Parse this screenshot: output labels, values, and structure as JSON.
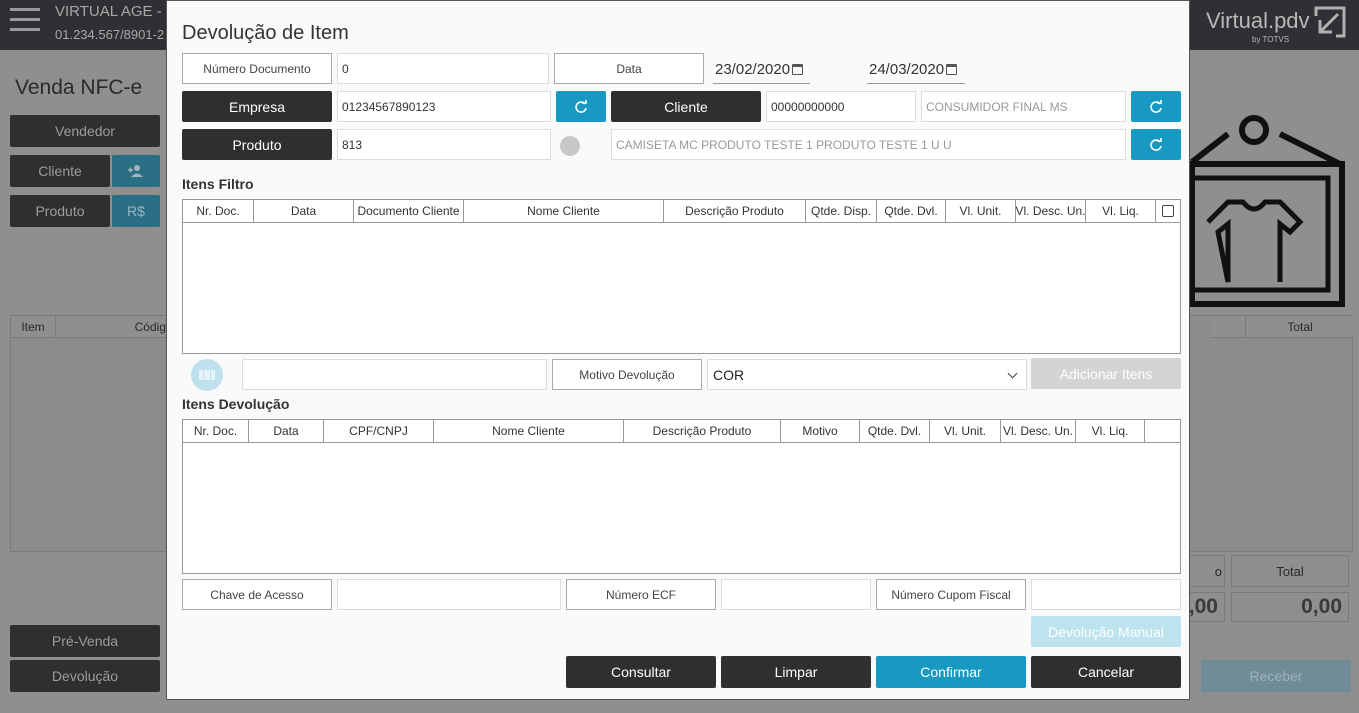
{
  "background": {
    "company_name": "VIRTUAL AGE - D",
    "cnpj": "01.234.567/8901-2",
    "brand": "Virtual.pdv",
    "brand_sub": "by TOTVS",
    "page_title": "Venda NFC-e",
    "buttons": {
      "vendedor": "Vendedor",
      "cliente": "Cliente",
      "produto": "Produto",
      "produto_side": "R$",
      "pre_venda": "Pré-Venda",
      "devolucao": "Devolução",
      "receber": "Receber"
    },
    "table_headers": {
      "item": "Item",
      "codigo": "Códig",
      "total": "Total"
    },
    "totals": {
      "label": "Total",
      "value": "0,00",
      "value_partial": ",00",
      "label_partial": "o"
    }
  },
  "modal": {
    "title": "Devolução de Item",
    "numero_documento_label": "Número Documento",
    "numero_documento_value": "0",
    "data_label": "Data",
    "date_start": "23/02/2020",
    "date_end": "24/03/2020",
    "empresa_label": "Empresa",
    "empresa_value": "01234567890123",
    "cliente_label": "Cliente",
    "cliente_value": "00000000000",
    "cliente_name": "CONSUMIDOR FINAL MS",
    "produto_label": "Produto",
    "produto_value": "813",
    "produto_desc": "CAMISETA MC PRODUTO TESTE 1 PRODUTO TESTE 1 U U",
    "itens_filtro_title": "Itens Filtro",
    "filtro_headers": [
      "Nr. Doc.",
      "Data",
      "Documento Cliente",
      "Nome Cliente",
      "Descrição Produto",
      "Qtde. Disp.",
      "Qtde. Dvl.",
      "Vl. Unit.",
      "Vl. Desc. Un.",
      "Vl. Liq."
    ],
    "motivo_label": "Motivo Devolução",
    "motivo_value": "COR",
    "adicionar_label": "Adicionar Itens",
    "itens_devolucao_title": "Itens Devolução",
    "devolucao_headers": [
      "Nr. Doc.",
      "Data",
      "CPF/CNPJ",
      "Nome Cliente",
      "Descrição Produto",
      "Motivo",
      "Qtde. Dvl.",
      "Vl. Unit.",
      "Vl. Desc. Un.",
      "Vl. Liq."
    ],
    "chave_label": "Chave de Acesso",
    "ecf_label": "Número ECF",
    "cupom_label": "Número Cupom Fiscal",
    "devolucao_manual_label": "Devolução Manual",
    "consultar_label": "Consultar",
    "limpar_label": "Limpar",
    "confirmar_label": "Confirmar",
    "cancelar_label": "Cancelar"
  },
  "colors": {
    "accent_blue": "#1899c2",
    "dark_button": "#2e2f31"
  }
}
